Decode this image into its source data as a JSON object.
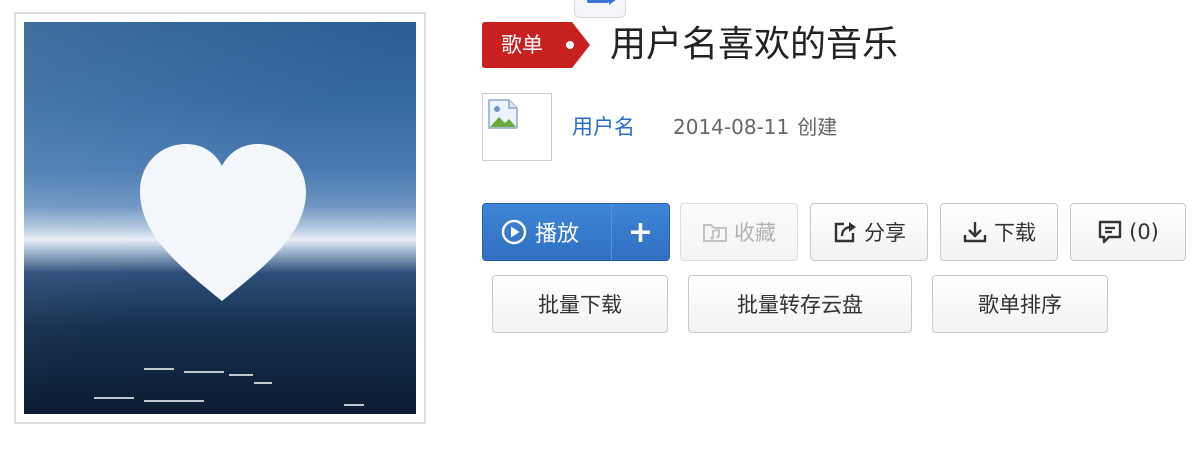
{
  "header": {
    "badge_label": "歌单",
    "title": "用户名喜欢的音乐"
  },
  "creator": {
    "name": "用户名",
    "date": "2014-08-11",
    "date_suffix": "创建"
  },
  "actions": {
    "play_label": "播放",
    "add_label": "+",
    "collect_label": "收藏",
    "share_label": "分享",
    "download_label": "下载",
    "comment_label": "(0)"
  },
  "batch_actions": {
    "batch_download_label": "批量下载",
    "save_to_cloud_label": "批量转存云盘",
    "sort_label": "歌单排序"
  },
  "icons": {
    "play": "play-circle-icon",
    "collect": "folder-music-icon",
    "share": "share-arrow-icon",
    "download": "download-tray-icon",
    "comment": "comment-bubble-icon",
    "avatar": "broken-image-icon"
  },
  "colors": {
    "primary_blue": "#2f6fc0",
    "badge_red": "#c8201e",
    "link_blue": "#2b6ec4"
  }
}
